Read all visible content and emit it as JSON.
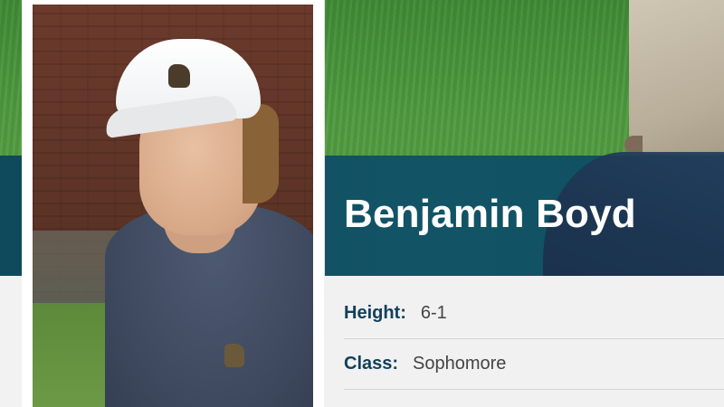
{
  "profile": {
    "name": "Benjamin Boyd",
    "details": [
      {
        "label": "Height:",
        "value": "6-1"
      },
      {
        "label": "Class:",
        "value": "Sophomore"
      }
    ]
  },
  "colors": {
    "band": "#125466",
    "label": "#13405a",
    "value": "#444444",
    "panel": "#f1f1f1"
  },
  "icons": [
    "player-headshot-photo"
  ]
}
